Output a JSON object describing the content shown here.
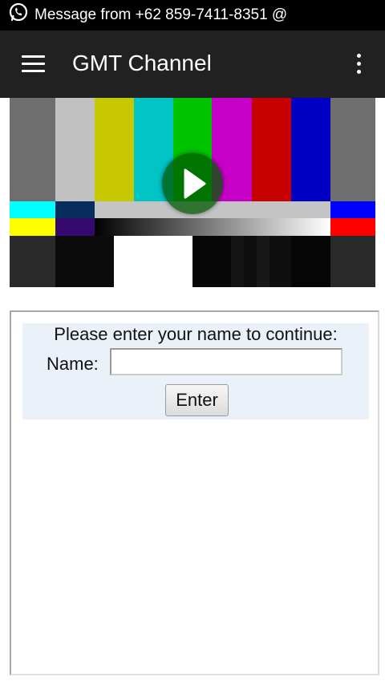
{
  "status_bar": {
    "notification_icon": "whatsapp-icon",
    "text": "Message from +62 859-7411-8351 @"
  },
  "app_bar": {
    "title": "GMT Channel",
    "menu_icon": "hamburger-menu-icon",
    "overflow_icon": "more-vert-icon"
  },
  "video": {
    "content": "color-bars-test-pattern",
    "control_icon": "play-icon"
  },
  "login_form": {
    "prompt": "Please enter your name to continue:",
    "name_label": "Name:",
    "name_value": "",
    "name_placeholder": "",
    "submit_label": "Enter"
  },
  "colors": {
    "app_bar": "#212121",
    "status_bar": "#000000",
    "form_background": "#ebf1f9",
    "play_button": "#005a00"
  }
}
